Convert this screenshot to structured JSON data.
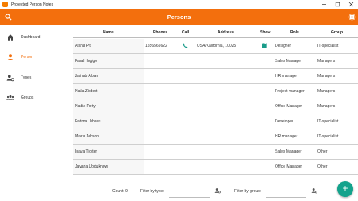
{
  "window": {
    "title": "Protected Person Notes"
  },
  "appbar": {
    "title": "Persons"
  },
  "sidebar": {
    "items": [
      {
        "label": "Dashboard",
        "icon": "home-icon",
        "active": false
      },
      {
        "label": "Person",
        "icon": "person-icon",
        "active": true
      },
      {
        "label": "Types",
        "icon": "types-icon",
        "active": false
      },
      {
        "label": "Groups",
        "icon": "groups-icon",
        "active": false
      }
    ]
  },
  "table": {
    "columns": [
      "Name",
      "Phones",
      "Call",
      "Address",
      "Show",
      "Role",
      "Group"
    ],
    "rows": [
      {
        "name": "Aisha Pit",
        "phone": "1556565622",
        "call": true,
        "address": "USA/Kalifornia, 10025",
        "show": true,
        "role": "Designer",
        "group": "IT-specialist"
      },
      {
        "name": "Farah Ingigo",
        "phone": "",
        "call": false,
        "address": "",
        "show": false,
        "role": "Sales Manager",
        "group": "Managers"
      },
      {
        "name": "Zainab Alban",
        "phone": "",
        "call": false,
        "address": "",
        "show": false,
        "role": "HR manager",
        "group": "Managers"
      },
      {
        "name": "Naila Zibbert",
        "phone": "",
        "call": false,
        "address": "",
        "show": false,
        "role": "Project manager",
        "group": "Managers"
      },
      {
        "name": "Nadia Potty",
        "phone": "",
        "call": false,
        "address": "",
        "show": false,
        "role": "Office Manager",
        "group": "Managers"
      },
      {
        "name": "Fatima Urboss",
        "phone": "",
        "call": false,
        "address": "",
        "show": false,
        "role": "Developer",
        "group": "IT-specialist"
      },
      {
        "name": "Maira Jobson",
        "phone": "",
        "call": false,
        "address": "",
        "show": false,
        "role": "HR manager",
        "group": "IT-specialist"
      },
      {
        "name": "Inaya Trotter",
        "phone": "",
        "call": false,
        "address": "",
        "show": false,
        "role": "Sales Manager",
        "group": "Other"
      },
      {
        "name": "Javaria Upduknow",
        "phone": "",
        "call": false,
        "address": "",
        "show": false,
        "role": "Office Manager",
        "group": "Other"
      }
    ]
  },
  "footer": {
    "count_label": "Count: 9",
    "filter_type_label": "Filter by type:",
    "filter_group_label": "Filter by group:"
  },
  "colors": {
    "accent": "#f36f0d",
    "fab": "#13a38c",
    "call_icon": "#1a9c8a"
  }
}
